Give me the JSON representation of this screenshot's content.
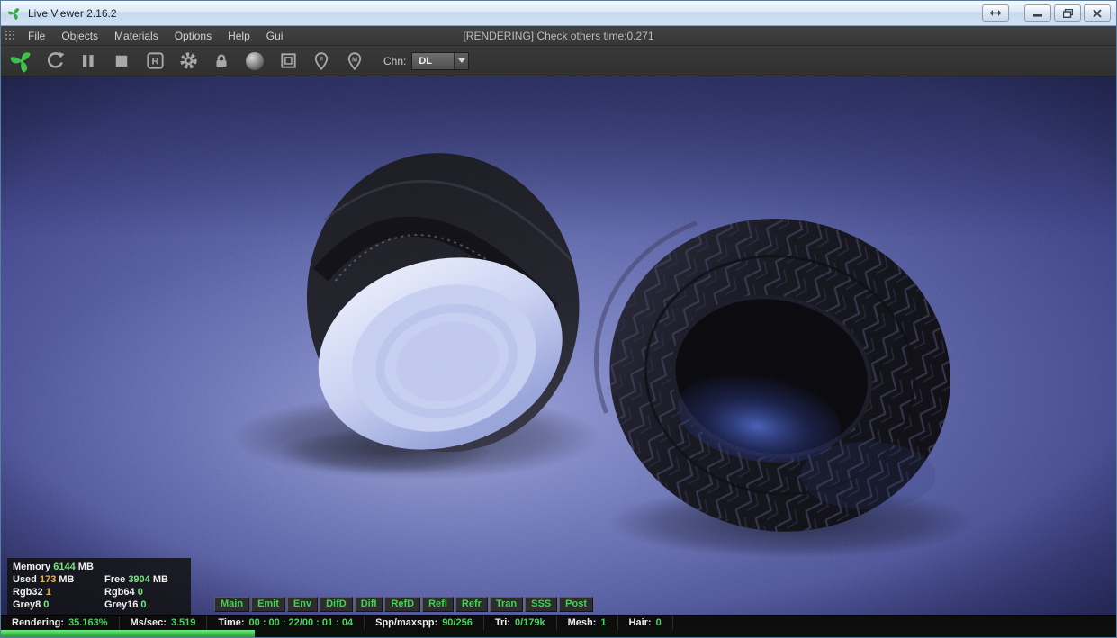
{
  "window": {
    "title": "Live Viewer 2.16.2"
  },
  "menu": {
    "items": [
      "File",
      "Objects",
      "Materials",
      "Options",
      "Help",
      "Gui"
    ],
    "status_center": "[RENDERING] Check others time:0.271"
  },
  "toolbar": {
    "r_letter": "R",
    "pin_focus_letter": "F",
    "pin_material_letter": "M",
    "chn_label": "Chn:",
    "chn_value": "DL",
    "icons": [
      "octane-logo",
      "restart-render",
      "pause-render",
      "stop-render",
      "render-priority",
      "settings-gear",
      "lock",
      "material-ball",
      "render-region",
      "focus-picker-pin",
      "material-picker-pin"
    ]
  },
  "viewport": {
    "description": "Noisy path-traced render: two tires on blue-violet floor; left tire tilted with pale blue rim face, right tire upright with feathered tread",
    "colors": {
      "floor_light": "#8289ca",
      "floor_dark": "#2b2f64",
      "rim_face": "#c9d2f4",
      "tire_dark": "#15151d",
      "hole_glow": "#4d66c8"
    }
  },
  "memory_panel": {
    "row1": {
      "label": "Memory",
      "value": "6144",
      "unit": "MB"
    },
    "row2a": {
      "label": "Used",
      "value": "173",
      "unit": "MB"
    },
    "row2b": {
      "label": "Free",
      "value": "3904",
      "unit": "MB"
    },
    "row3a": {
      "label": "Rgb32",
      "value": "1"
    },
    "row3b": {
      "label": "Rgb64",
      "value": "0"
    },
    "row4a": {
      "label": "Grey8",
      "value": "0"
    },
    "row4b": {
      "label": "Grey16",
      "value": "0"
    }
  },
  "passes": [
    "Main",
    "Emit",
    "Env",
    "DifD",
    "DifI",
    "RefD",
    "RefI",
    "Refr",
    "Tran",
    "SSS",
    "Post"
  ],
  "status_bar": {
    "segments": [
      {
        "label": "Rendering:",
        "value": "35.163%"
      },
      {
        "label": "Ms/sec:",
        "value": "3.519"
      },
      {
        "label": "Time:",
        "value": "00 : 00 : 22/00 : 01 : 04"
      },
      {
        "label": "Spp/maxspp:",
        "value": "90/256"
      },
      {
        "label": "Tri:",
        "value": "0/179k"
      },
      {
        "label": "Mesh:",
        "value": "1"
      },
      {
        "label": "Hair:",
        "value": "0"
      }
    ],
    "progress_bar_percent": 22.8
  }
}
